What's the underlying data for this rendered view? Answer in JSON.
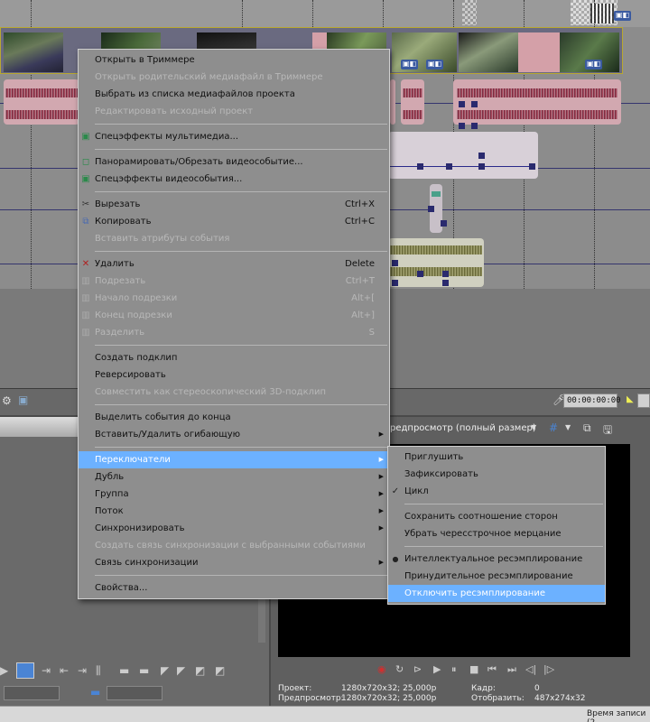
{
  "context_menu": {
    "groups": [
      [
        {
          "label": "Открыть в Триммере",
          "disabled": false
        },
        {
          "label": "Открыть родительский медиафайл в Триммере",
          "disabled": true
        },
        {
          "label": "Выбрать из списка медиафайлов проекта",
          "disabled": false
        },
        {
          "label": "Редактировать исходный проект",
          "disabled": true
        }
      ],
      [
        {
          "label": "Спецэффекты мультимедиа...",
          "disabled": false,
          "icon": "media-fx-icon"
        }
      ],
      [
        {
          "label": "Панорамировать/Обрезать видеособытие...",
          "disabled": false,
          "icon": "pan-crop-icon"
        },
        {
          "label": "Спецэффекты видеособытия...",
          "disabled": false,
          "icon": "event-fx-icon"
        }
      ],
      [
        {
          "label": "Вырезать",
          "shortcut": "Ctrl+X",
          "disabled": false,
          "icon": "scissors-icon"
        },
        {
          "label": "Копировать",
          "shortcut": "Ctrl+C",
          "disabled": false,
          "icon": "copy-icon"
        },
        {
          "label": "Вставить атрибуты события",
          "disabled": true
        }
      ],
      [
        {
          "label": "Удалить",
          "shortcut": "Delete",
          "disabled": false,
          "icon": "delete-icon"
        },
        {
          "label": "Подрезать",
          "shortcut": "Ctrl+T",
          "disabled": true,
          "icon": "trim-icon"
        },
        {
          "label": "Начало подрезки",
          "shortcut": "Alt+[",
          "disabled": true,
          "icon": "trim-start-icon"
        },
        {
          "label": "Конец подрезки",
          "shortcut": "Alt+]",
          "disabled": true,
          "icon": "trim-end-icon"
        },
        {
          "label": "Разделить",
          "shortcut": "S",
          "disabled": true,
          "icon": "split-icon"
        }
      ],
      [
        {
          "label": "Создать подклип",
          "disabled": false
        },
        {
          "label": "Реверсировать",
          "disabled": false
        },
        {
          "label": "Совместить как стереоскопический 3D-подклип",
          "disabled": true
        }
      ],
      [
        {
          "label": "Выделить события до конца",
          "disabled": false
        },
        {
          "label": "Вставить/Удалить огибающую",
          "disabled": false,
          "submenu": true
        }
      ],
      [
        {
          "label": "Переключатели",
          "disabled": false,
          "submenu": true,
          "highlighted": true
        },
        {
          "label": "Дубль",
          "disabled": false,
          "submenu": true
        },
        {
          "label": "Группа",
          "disabled": false,
          "submenu": true
        },
        {
          "label": "Поток",
          "disabled": false,
          "submenu": true
        },
        {
          "label": "Синхронизировать",
          "disabled": false,
          "submenu": true
        },
        {
          "label": "Создать связь синхронизации с выбранными событиями",
          "disabled": true
        },
        {
          "label": "Связь синхронизации",
          "disabled": false,
          "submenu": true
        }
      ],
      [
        {
          "label": "Свойства...",
          "disabled": false
        }
      ]
    ]
  },
  "switches_submenu": {
    "groups": [
      [
        {
          "label": "Приглушить",
          "checked": false
        },
        {
          "label": "Зафиксировать",
          "checked": false
        },
        {
          "label": "Цикл",
          "checked": true
        }
      ],
      [
        {
          "label": "Сохранить соотношение сторон",
          "checked": false
        },
        {
          "label": "Убрать чересстрочное мерцание",
          "checked": false
        }
      ],
      [
        {
          "label": "Интеллектуальное ресэмплирование",
          "checked": false,
          "radio": true
        },
        {
          "label": "Принудительное ресэмплирование",
          "checked": false
        },
        {
          "label": "Отключить ресэмплирование",
          "checked": false,
          "highlighted": true
        }
      ]
    ]
  },
  "preview_toolbar": {
    "quality": "редпросмотр (полный размер)"
  },
  "timecode": "00:00:00:00",
  "preview_info": {
    "project_label": "Проект:",
    "project_value": "1280x720x32; 25,000p",
    "preview_label": "Предпросмотр:",
    "preview_value": "1280x720x32; 25,000p",
    "frame_label": "Кадр:",
    "frame_value": "0",
    "display_label": "Отобразить:",
    "display_value": "487x274x32"
  },
  "status_text": "Время записи (2",
  "colors": {
    "menu_bg": "#8e8e8e",
    "highlight": "#6cb1ff",
    "disabled_text": "#b8b8b8",
    "record": "#d03030"
  }
}
